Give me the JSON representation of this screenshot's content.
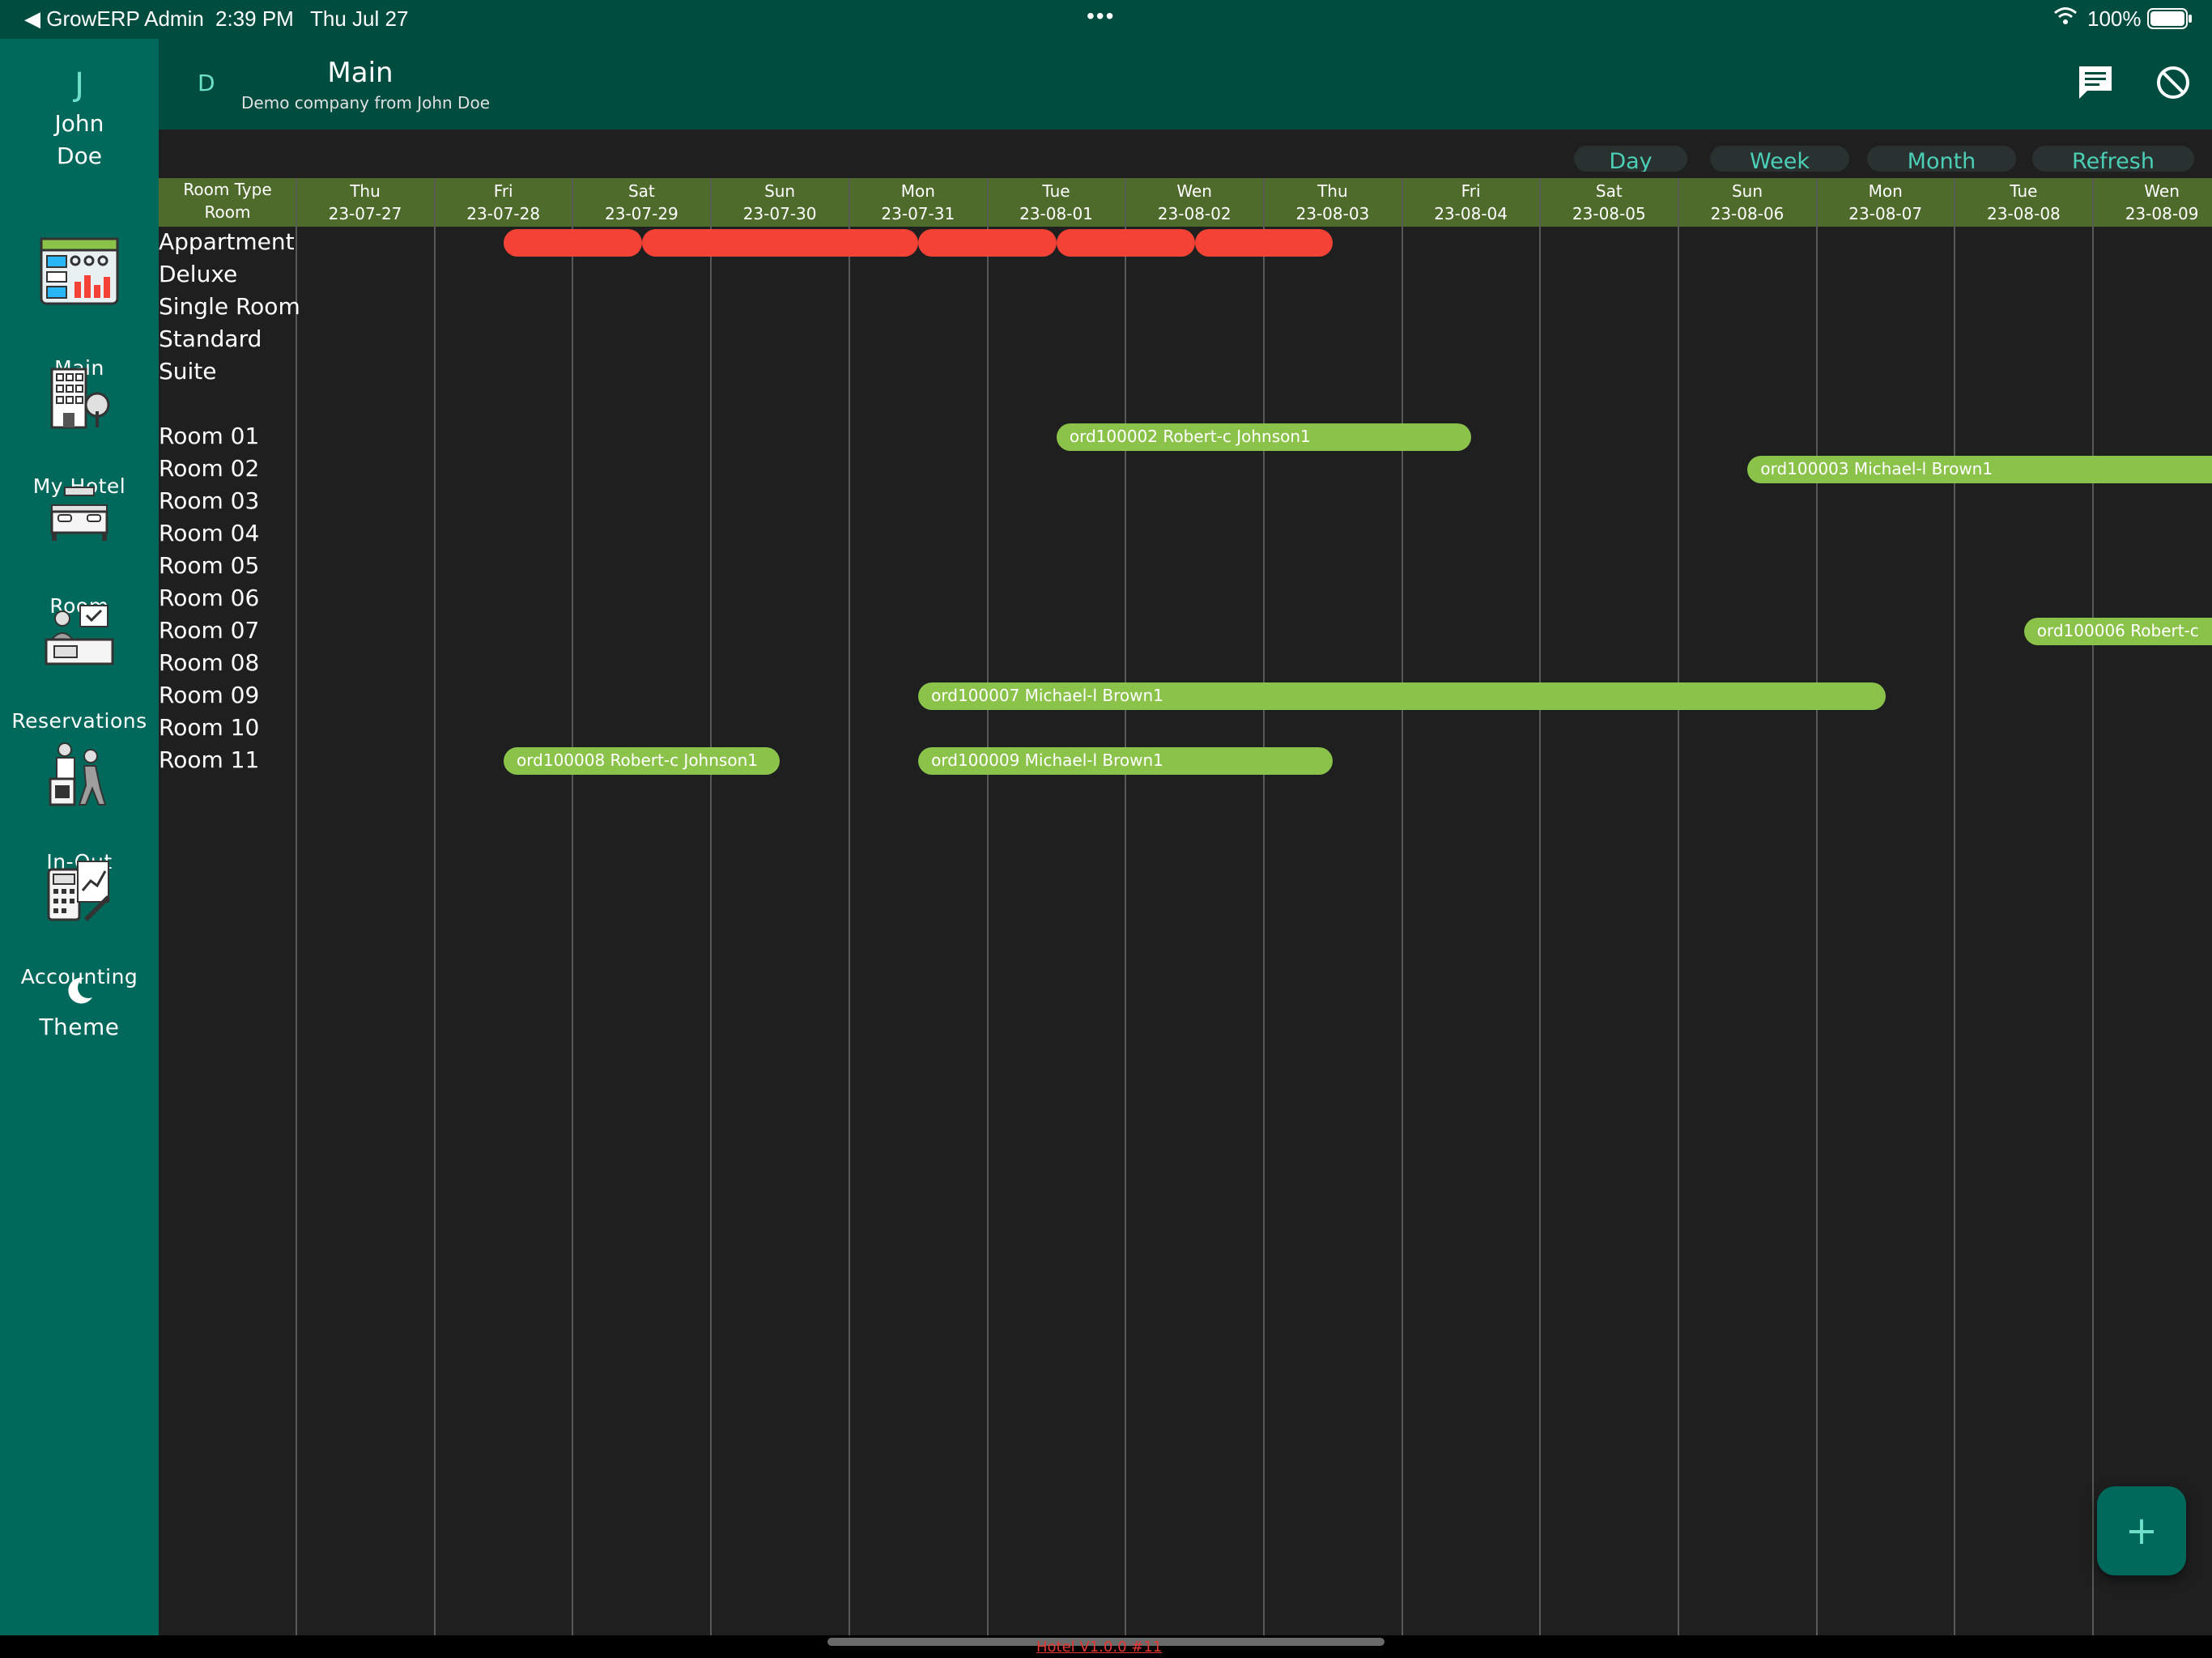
{
  "status_bar": {
    "back_app": "◀ GrowERP Admin",
    "time": "2:39 PM",
    "date": "Thu Jul 27",
    "dots": "•••",
    "battery_text": "100%"
  },
  "user": {
    "initial": "J",
    "first_name": "John",
    "last_name": "Doe"
  },
  "sidebar": {
    "items": [
      {
        "label": "Main",
        "icon": "dashboard-icon"
      },
      {
        "label": "My Hotel",
        "icon": "hotel-building-icon"
      },
      {
        "label": "Room",
        "icon": "room-bed-icon"
      },
      {
        "label": "Reservations",
        "icon": "reservations-desk-icon"
      },
      {
        "label": "In-Out",
        "icon": "bellhop-luggage-icon"
      },
      {
        "label": "Accounting",
        "icon": "accounting-calculator-icon"
      },
      {
        "label": "Theme",
        "icon": "moon-icon"
      }
    ]
  },
  "header": {
    "company_initial": "D",
    "title": "Main",
    "subtitle": "Demo company from John Doe",
    "actions": [
      {
        "name": "chat",
        "icon": "chat-icon"
      },
      {
        "name": "logout",
        "icon": "block-icon"
      }
    ]
  },
  "view_buttons": {
    "day": "Day",
    "week": "Week",
    "month": "Month",
    "refresh": "Refresh"
  },
  "gantt": {
    "corner_top": "Room Type",
    "corner_bottom": "Room",
    "days": [
      {
        "dow": "Thu",
        "date": "23-07-27"
      },
      {
        "dow": "Fri",
        "date": "23-07-28"
      },
      {
        "dow": "Sat",
        "date": "23-07-29"
      },
      {
        "dow": "Sun",
        "date": "23-07-30"
      },
      {
        "dow": "Mon",
        "date": "23-07-31"
      },
      {
        "dow": "Tue",
        "date": "23-08-01"
      },
      {
        "dow": "Wen",
        "date": "23-08-02"
      },
      {
        "dow": "Thu",
        "date": "23-08-03"
      },
      {
        "dow": "Fri",
        "date": "23-08-04"
      },
      {
        "dow": "Sat",
        "date": "23-08-05"
      },
      {
        "dow": "Sun",
        "date": "23-08-06"
      },
      {
        "dow": "Mon",
        "date": "23-08-07"
      },
      {
        "dow": "Tue",
        "date": "23-08-08"
      },
      {
        "dow": "Wen",
        "date": "23-08-09"
      }
    ],
    "rows": [
      "Appartment",
      "Deluxe",
      "Single Room",
      "Standard",
      "Suite",
      "",
      "Room 01",
      "Room 02",
      "Room 03",
      "Room 04",
      "Room 05",
      "Room 06",
      "Room 07",
      "Room 08",
      "Room 09",
      "Room 10",
      "Room 11"
    ],
    "bookings": [
      {
        "row": 0,
        "start": "23-07-28",
        "end": "23-07-29",
        "color": "red",
        "label": ""
      },
      {
        "row": 0,
        "start": "23-07-29",
        "end": "23-07-31",
        "color": "red",
        "label": ""
      },
      {
        "row": 0,
        "start": "23-07-31",
        "end": "23-08-01",
        "color": "red",
        "label": ""
      },
      {
        "row": 0,
        "start": "23-08-01",
        "end": "23-08-02",
        "color": "red",
        "label": ""
      },
      {
        "row": 0,
        "start": "23-08-02",
        "end": "23-08-03",
        "color": "red",
        "label": ""
      },
      {
        "row": 6,
        "start": "23-08-01",
        "end": "23-08-04",
        "color": "green",
        "label": "ord100002  Robert-c Johnson1"
      },
      {
        "row": 7,
        "start": "23-08-06",
        "end": "23-08-11",
        "color": "green",
        "label": "ord100003  Michael-l Brown1"
      },
      {
        "row": 12,
        "start": "23-08-08",
        "end": "23-08-11",
        "color": "green",
        "label": "ord100006  Robert-c"
      },
      {
        "row": 14,
        "start": "23-07-31",
        "end": "23-08-07",
        "color": "green",
        "label": "ord100007  Michael-l Brown1"
      },
      {
        "row": 16,
        "start": "23-07-28",
        "end": "23-07-30",
        "color": "green",
        "label": "ord100008  Robert-c Johnson1"
      },
      {
        "row": 16,
        "start": "23-07-31",
        "end": "23-08-03",
        "color": "green",
        "label": "ord100009  Michael-l Brown1"
      }
    ]
  },
  "fab": {
    "icon": "plus-icon",
    "symbol": "+"
  },
  "footer": {
    "version": "Hotel V1.0.0 #11"
  }
}
